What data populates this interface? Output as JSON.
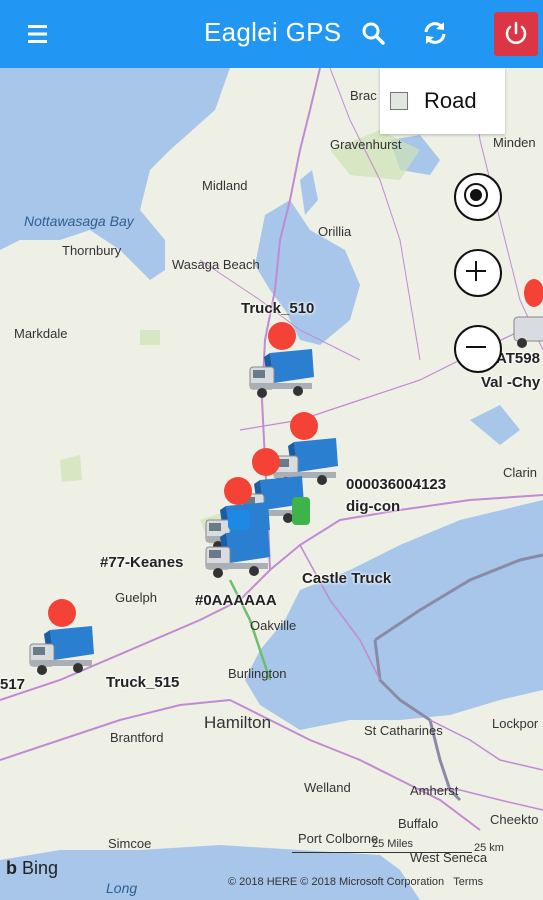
{
  "header": {
    "title": "Eaglei GPS",
    "menu_icon": "hamburger-menu-icon",
    "search_icon": "search-icon",
    "refresh_icon": "refresh-icon",
    "power_icon": "power-icon",
    "bar_color": "#2196f3",
    "power_color": "#dc3545"
  },
  "map_type": {
    "label": "Road"
  },
  "controls": {
    "locate_icon": "locate-icon",
    "zoom_in_icon": "plus-icon",
    "zoom_out_icon": "minus-icon"
  },
  "places": [
    {
      "name": "Bracebridge_part",
      "label": "Brac"
    },
    {
      "name": "Gravenhurst",
      "label": "Gravenhurst"
    },
    {
      "name": "Minden",
      "label": "Minden"
    },
    {
      "name": "Midland",
      "label": "Midland"
    },
    {
      "name": "Nottawasaga Bay",
      "label": "Nottawasaga Bay"
    },
    {
      "name": "Thornbury",
      "label": "Thornbury"
    },
    {
      "name": "Orillia",
      "label": "Orillia"
    },
    {
      "name": "Wasaga Beach",
      "label": "Wasaga Beach"
    },
    {
      "name": "Markdale",
      "label": "Markdale"
    },
    {
      "name": "Clarington_part",
      "label": "Clarin"
    },
    {
      "name": "Guelph",
      "label": "Guelph"
    },
    {
      "name": "Oakville",
      "label": "Oakville"
    },
    {
      "name": "Burlington",
      "label": "Burlington"
    },
    {
      "name": "Hamilton",
      "label": "Hamilton"
    },
    {
      "name": "Lockport_part",
      "label": "Lockpor"
    },
    {
      "name": "Brantford",
      "label": "Brantford"
    },
    {
      "name": "St Catharines",
      "label": "St Catharines"
    },
    {
      "name": "Welland",
      "label": "Welland"
    },
    {
      "name": "Amherst",
      "label": "Amherst"
    },
    {
      "name": "Buffalo",
      "label": "Buffalo"
    },
    {
      "name": "Cheektowaga_part",
      "label": "Cheekto"
    },
    {
      "name": "Simcoe",
      "label": "Simcoe"
    },
    {
      "name": "Port Colborne",
      "label": "Port Colborne"
    },
    {
      "name": "West Seneca_part",
      "label": "West Seneca"
    },
    {
      "name": "Long Point_part",
      "label": "Long"
    }
  ],
  "vehicles": [
    {
      "label": "Truck_510"
    },
    {
      "label": "AT598"
    },
    {
      "label": "Val -Chy"
    },
    {
      "label": "000036004123"
    },
    {
      "label": "dig-con"
    },
    {
      "label": "#77-Keanes"
    },
    {
      "label": "Castle Truck"
    },
    {
      "label": "#0AAAAAA"
    },
    {
      "label": "Truck_515"
    },
    {
      "label": "517"
    }
  ],
  "footer": {
    "bing": "Bing",
    "scale_miles": "25 Miles",
    "scale_km": "25 km",
    "copyright": "© 2018 HERE © 2018 Microsoft Corporation",
    "terms": "Terms"
  }
}
